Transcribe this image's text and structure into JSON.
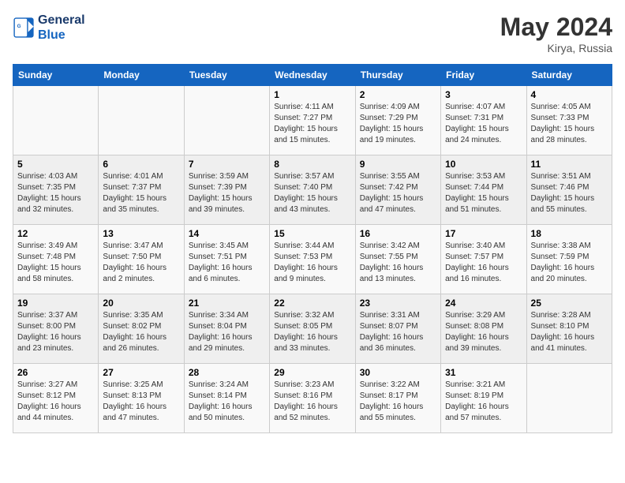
{
  "header": {
    "logo_line1": "General",
    "logo_line2": "Blue",
    "month": "May 2024",
    "location": "Kirya, Russia"
  },
  "weekdays": [
    "Sunday",
    "Monday",
    "Tuesday",
    "Wednesday",
    "Thursday",
    "Friday",
    "Saturday"
  ],
  "weeks": [
    [
      {
        "day": "",
        "info": ""
      },
      {
        "day": "",
        "info": ""
      },
      {
        "day": "",
        "info": ""
      },
      {
        "day": "1",
        "info": "Sunrise: 4:11 AM\nSunset: 7:27 PM\nDaylight: 15 hours\nand 15 minutes."
      },
      {
        "day": "2",
        "info": "Sunrise: 4:09 AM\nSunset: 7:29 PM\nDaylight: 15 hours\nand 19 minutes."
      },
      {
        "day": "3",
        "info": "Sunrise: 4:07 AM\nSunset: 7:31 PM\nDaylight: 15 hours\nand 24 minutes."
      },
      {
        "day": "4",
        "info": "Sunrise: 4:05 AM\nSunset: 7:33 PM\nDaylight: 15 hours\nand 28 minutes."
      }
    ],
    [
      {
        "day": "5",
        "info": "Sunrise: 4:03 AM\nSunset: 7:35 PM\nDaylight: 15 hours\nand 32 minutes."
      },
      {
        "day": "6",
        "info": "Sunrise: 4:01 AM\nSunset: 7:37 PM\nDaylight: 15 hours\nand 35 minutes."
      },
      {
        "day": "7",
        "info": "Sunrise: 3:59 AM\nSunset: 7:39 PM\nDaylight: 15 hours\nand 39 minutes."
      },
      {
        "day": "8",
        "info": "Sunrise: 3:57 AM\nSunset: 7:40 PM\nDaylight: 15 hours\nand 43 minutes."
      },
      {
        "day": "9",
        "info": "Sunrise: 3:55 AM\nSunset: 7:42 PM\nDaylight: 15 hours\nand 47 minutes."
      },
      {
        "day": "10",
        "info": "Sunrise: 3:53 AM\nSunset: 7:44 PM\nDaylight: 15 hours\nand 51 minutes."
      },
      {
        "day": "11",
        "info": "Sunrise: 3:51 AM\nSunset: 7:46 PM\nDaylight: 15 hours\nand 55 minutes."
      }
    ],
    [
      {
        "day": "12",
        "info": "Sunrise: 3:49 AM\nSunset: 7:48 PM\nDaylight: 15 hours\nand 58 minutes."
      },
      {
        "day": "13",
        "info": "Sunrise: 3:47 AM\nSunset: 7:50 PM\nDaylight: 16 hours\nand 2 minutes."
      },
      {
        "day": "14",
        "info": "Sunrise: 3:45 AM\nSunset: 7:51 PM\nDaylight: 16 hours\nand 6 minutes."
      },
      {
        "day": "15",
        "info": "Sunrise: 3:44 AM\nSunset: 7:53 PM\nDaylight: 16 hours\nand 9 minutes."
      },
      {
        "day": "16",
        "info": "Sunrise: 3:42 AM\nSunset: 7:55 PM\nDaylight: 16 hours\nand 13 minutes."
      },
      {
        "day": "17",
        "info": "Sunrise: 3:40 AM\nSunset: 7:57 PM\nDaylight: 16 hours\nand 16 minutes."
      },
      {
        "day": "18",
        "info": "Sunrise: 3:38 AM\nSunset: 7:59 PM\nDaylight: 16 hours\nand 20 minutes."
      }
    ],
    [
      {
        "day": "19",
        "info": "Sunrise: 3:37 AM\nSunset: 8:00 PM\nDaylight: 16 hours\nand 23 minutes."
      },
      {
        "day": "20",
        "info": "Sunrise: 3:35 AM\nSunset: 8:02 PM\nDaylight: 16 hours\nand 26 minutes."
      },
      {
        "day": "21",
        "info": "Sunrise: 3:34 AM\nSunset: 8:04 PM\nDaylight: 16 hours\nand 29 minutes."
      },
      {
        "day": "22",
        "info": "Sunrise: 3:32 AM\nSunset: 8:05 PM\nDaylight: 16 hours\nand 33 minutes."
      },
      {
        "day": "23",
        "info": "Sunrise: 3:31 AM\nSunset: 8:07 PM\nDaylight: 16 hours\nand 36 minutes."
      },
      {
        "day": "24",
        "info": "Sunrise: 3:29 AM\nSunset: 8:08 PM\nDaylight: 16 hours\nand 39 minutes."
      },
      {
        "day": "25",
        "info": "Sunrise: 3:28 AM\nSunset: 8:10 PM\nDaylight: 16 hours\nand 41 minutes."
      }
    ],
    [
      {
        "day": "26",
        "info": "Sunrise: 3:27 AM\nSunset: 8:12 PM\nDaylight: 16 hours\nand 44 minutes."
      },
      {
        "day": "27",
        "info": "Sunrise: 3:25 AM\nSunset: 8:13 PM\nDaylight: 16 hours\nand 47 minutes."
      },
      {
        "day": "28",
        "info": "Sunrise: 3:24 AM\nSunset: 8:14 PM\nDaylight: 16 hours\nand 50 minutes."
      },
      {
        "day": "29",
        "info": "Sunrise: 3:23 AM\nSunset: 8:16 PM\nDaylight: 16 hours\nand 52 minutes."
      },
      {
        "day": "30",
        "info": "Sunrise: 3:22 AM\nSunset: 8:17 PM\nDaylight: 16 hours\nand 55 minutes."
      },
      {
        "day": "31",
        "info": "Sunrise: 3:21 AM\nSunset: 8:19 PM\nDaylight: 16 hours\nand 57 minutes."
      },
      {
        "day": "",
        "info": ""
      }
    ]
  ]
}
